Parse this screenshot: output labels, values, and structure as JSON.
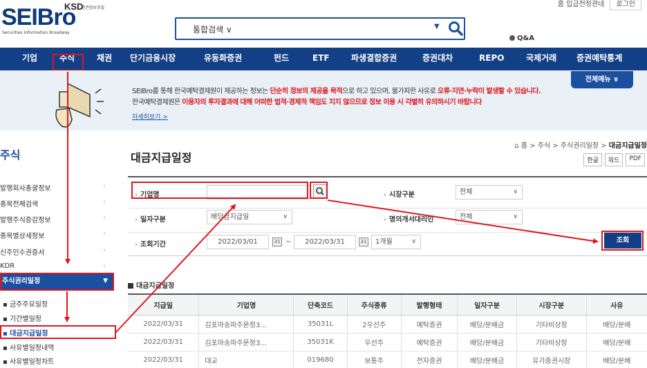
{
  "logo": {
    "main": "SEIBro",
    "ksd": "KSD",
    "ksd_sub": "증권정보포털",
    "sub": "Securities Information Broadway"
  },
  "top_util": {
    "links": "홈   입급전정관네",
    "login": "로그인"
  },
  "search": {
    "category": "통합검색 ∨"
  },
  "qa": "Q&A",
  "nav": [
    "기업",
    "주식",
    "채권",
    "단기금융시장",
    "유동화증권",
    "펀드",
    "ETF",
    "파생결합증권",
    "증권대차",
    "REPO",
    "국제거래",
    "증권예탁통계"
  ],
  "banner": {
    "line1_a": "SEIBro를 통해 한국예탁결제원이 제공하는 정보는 ",
    "line1_b": "단순히 정보의 제공을 목적",
    "line1_c": "으로 하고 있으며, 불가피한 사유로 ",
    "line1_d": "오류·지연·누락이 발생할 수 있습니다.",
    "line2_a": "한국예탁결제원은 ",
    "line2_b": "이용자의 투자결과에 대해 어떠한 법적·경제적 책임도 지지 않으므로 정보 이용 시 각별히 유의하시기 바랍니다",
    "more": "자세히보기 >",
    "fullmenu": "전체메뉴 ∨"
  },
  "sidebar": {
    "title": "주식",
    "items": [
      "발행회사총괄정보",
      "종목전체검색",
      "발행주식증감정보",
      "종목별상세정보",
      "신주인수권증서",
      "KDR"
    ],
    "active": "주식권리일정",
    "sub": [
      "금주주요일정",
      "기간별일정",
      "대금지급일정",
      "사유별일정내역",
      "사유별일정차트"
    ]
  },
  "page": {
    "title": "대금지급일정",
    "breadcrumb_a": "홈 > 주식 > 주식권리일정 > ",
    "breadcrumb_b": "대금지급일정",
    "exports": [
      "한글",
      "워드",
      "PDF"
    ]
  },
  "filter": {
    "company_label": "기업명",
    "company_value": "",
    "market_label": "시장구분",
    "market_value": "전체",
    "date_type_label": "일자구분",
    "date_type_value": "배당금지급일",
    "agent_label": "명의개서대리인",
    "agent_value": "전체",
    "period_label": "조회기간",
    "date_from": "2022/03/01",
    "tilde": "~",
    "date_to": "2022/03/31",
    "period_value": "1개월",
    "search_button": "조회"
  },
  "table": {
    "caption": "대금지급일정",
    "headers": [
      "지급일",
      "기업명",
      "단축코드",
      "주식종류",
      "발행형태",
      "일자구분",
      "시장구분",
      "사유"
    ],
    "rows": [
      [
        "2022/03/31",
        "김포마송파주운정3…",
        "35031L",
        "2우선주",
        "예탁증권",
        "배당/분배금",
        "기타비상장",
        "배당/분배"
      ],
      [
        "2022/03/31",
        "김포마송파주운정3…",
        "35031K",
        "우선주",
        "예탁증권",
        "배당/분배금",
        "기타비상장",
        "배당/분배"
      ],
      [
        "2022/03/31",
        "대교",
        "019680",
        "보통주",
        "전자증권",
        "배당/분배금",
        "유가증권시장",
        "배당/분배"
      ]
    ]
  },
  "colors": {
    "navy": "#123f85",
    "blue": "#1b4fa0",
    "red": "#e0151c"
  }
}
